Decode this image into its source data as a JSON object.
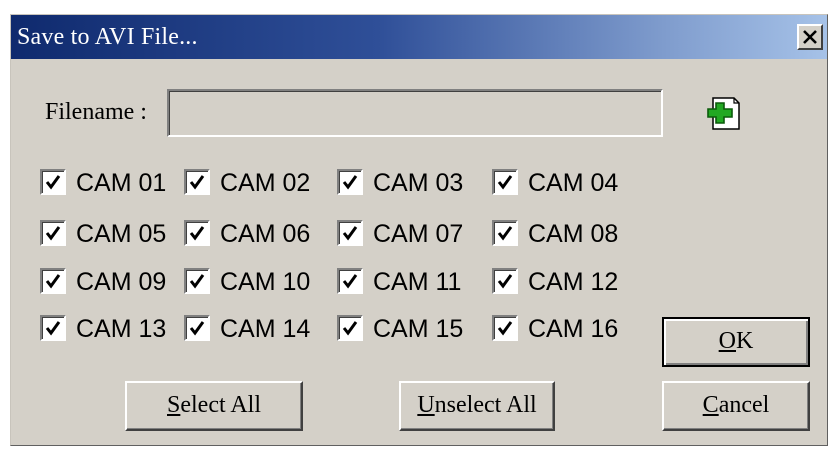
{
  "window": {
    "title": "Save to AVI File...",
    "close_label": "×"
  },
  "filename": {
    "label": "Filename :",
    "value": "",
    "placeholder": ""
  },
  "cameras": [
    {
      "label": "CAM 01",
      "checked": true
    },
    {
      "label": "CAM 02",
      "checked": true
    },
    {
      "label": "CAM 03",
      "checked": true
    },
    {
      "label": "CAM 04",
      "checked": true
    },
    {
      "label": "CAM 05",
      "checked": true
    },
    {
      "label": "CAM 06",
      "checked": true
    },
    {
      "label": "CAM 07",
      "checked": true
    },
    {
      "label": "CAM 08",
      "checked": true
    },
    {
      "label": "CAM 09",
      "checked": true
    },
    {
      "label": "CAM 10",
      "checked": true
    },
    {
      "label": "CAM 11",
      "checked": true
    },
    {
      "label": "CAM 12",
      "checked": true
    },
    {
      "label": "CAM 13",
      "checked": true
    },
    {
      "label": "CAM 14",
      "checked": true
    },
    {
      "label": "CAM 15",
      "checked": true
    },
    {
      "label": "CAM 16",
      "checked": true
    }
  ],
  "buttons": {
    "ok": {
      "mnemonic": "O",
      "rest": "K"
    },
    "cancel": {
      "mnemonic": "C",
      "rest": "ancel"
    },
    "select_all": {
      "mnemonic": "S",
      "rest": "elect All"
    },
    "unselect_all": {
      "mnemonic": "U",
      "rest": "nselect All"
    }
  },
  "icons": {
    "add": "plus-icon",
    "close": "close-icon",
    "check": "checkmark-icon"
  },
  "colors": {
    "face": "#d4d0c8",
    "title_start": "#0f2a6e",
    "title_end": "#a6c2e8",
    "plus": "#22a822"
  }
}
